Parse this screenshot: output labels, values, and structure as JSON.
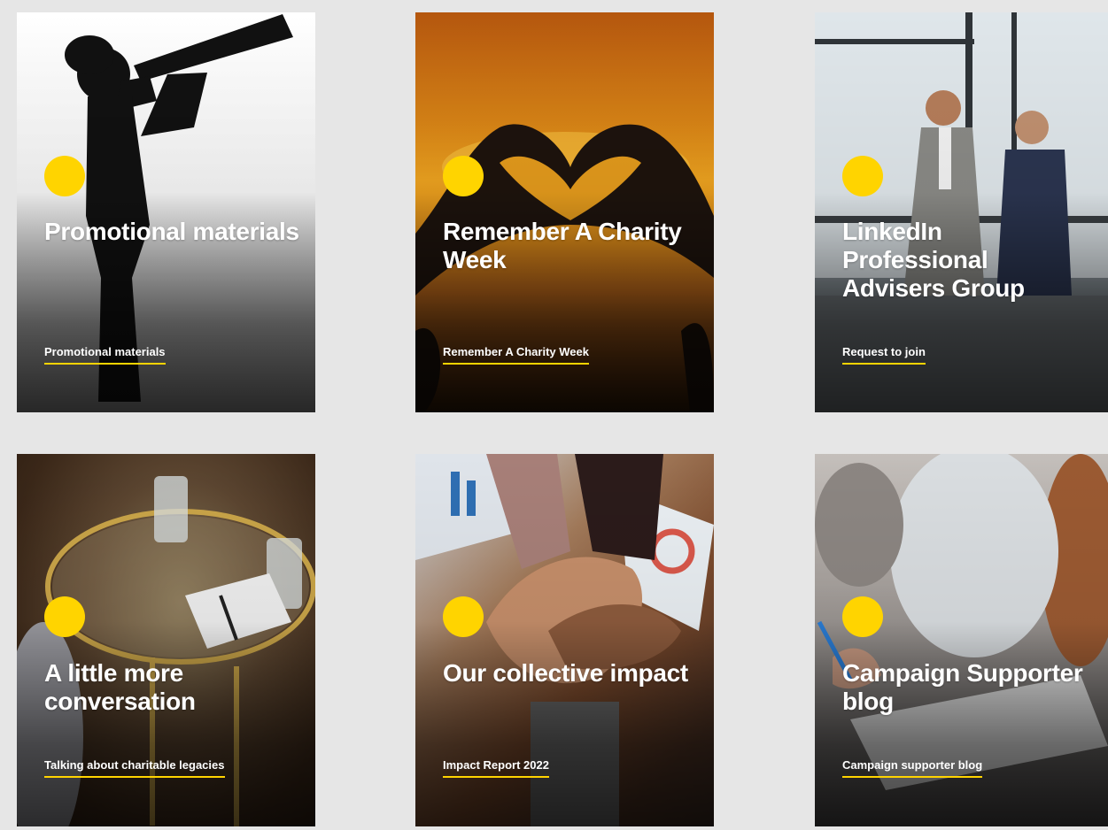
{
  "cards": [
    {
      "title": "Promotional materials",
      "link": "Promotional materials"
    },
    {
      "title": "Remember A Charity Week",
      "link": "Remember A Charity Week"
    },
    {
      "title": "LinkedIn Professional Advisers Group",
      "link": "Request to join"
    },
    {
      "title": "A little more conversation",
      "link": "Talking about charitable legacies"
    },
    {
      "title": "Our collective impact",
      "link": "Impact Report 2022"
    },
    {
      "title": "Campaign Supporter blog",
      "link": "Campaign supporter blog"
    }
  ],
  "colors": {
    "accent": "#ffd400",
    "background": "#e6e6e6",
    "text": "#ffffff"
  },
  "icons": [
    "yellow-dot-icon"
  ]
}
